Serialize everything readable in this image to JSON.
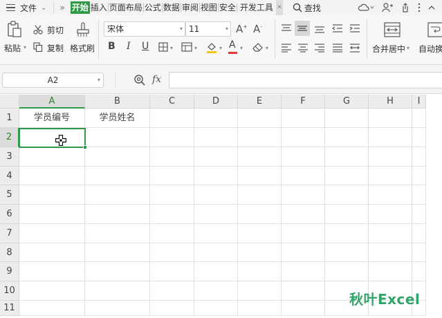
{
  "menu": {
    "file_label": "文件",
    "tabs": [
      {
        "label": "开始",
        "active": true
      },
      {
        "label": "插入"
      },
      {
        "label": "页面布局"
      },
      {
        "label": "公式"
      },
      {
        "label": "数据"
      },
      {
        "label": "审阅"
      },
      {
        "label": "视图"
      },
      {
        "label": "安全"
      },
      {
        "label": "开发工具"
      }
    ],
    "search_label": "查找"
  },
  "ribbon": {
    "paste_label": "粘贴",
    "cut_label": "剪切",
    "copy_label": "复制",
    "format_painter_label": "格式刷",
    "font_name": "宋体",
    "font_size": "11",
    "merge_center_label": "合并居中",
    "wrap_label": "自动换"
  },
  "formula_bar": {
    "name_box": "A2",
    "fx_label": "fx",
    "formula_value": ""
  },
  "sheet": {
    "columns": [
      "A",
      "B",
      "C",
      "D",
      "E",
      "F",
      "G",
      "H",
      "I"
    ],
    "rows": [
      "1",
      "2",
      "3",
      "4",
      "5",
      "6",
      "7",
      "8",
      "9",
      "10",
      "11"
    ],
    "cells": {
      "A1": "学员编号",
      "B1": "学员姓名"
    },
    "selected_cell": "A2"
  },
  "watermark": "秋叶Excel",
  "colors": {
    "accent": "#2e9a47",
    "watermark": "#2fa56a"
  }
}
